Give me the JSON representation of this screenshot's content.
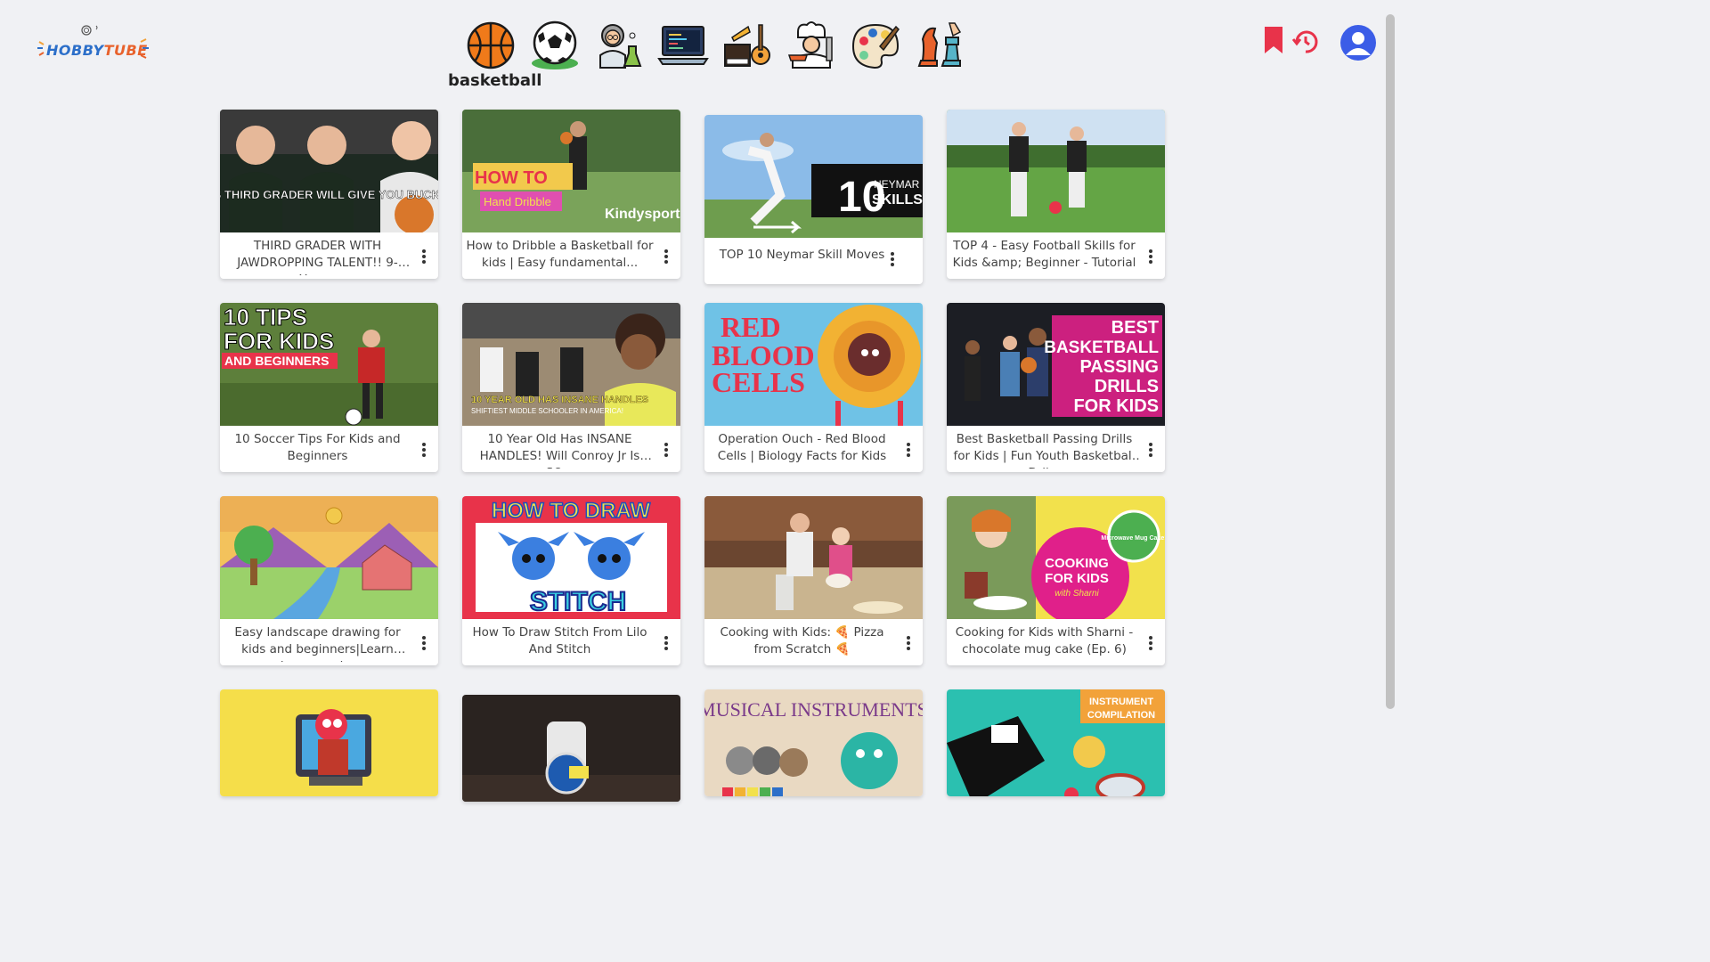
{
  "header": {
    "logo_text_a": "HOBBY",
    "logo_text_b": "TUBE",
    "categories": [
      {
        "name": "basketball",
        "icon": "basketball-icon",
        "selected": true
      },
      {
        "name": "soccer",
        "icon": "soccer-ball-icon"
      },
      {
        "name": "science",
        "icon": "scientist-icon"
      },
      {
        "name": "coding",
        "icon": "laptop-code-icon"
      },
      {
        "name": "music",
        "icon": "musical-instruments-icon"
      },
      {
        "name": "cooking",
        "icon": "chef-icon"
      },
      {
        "name": "art",
        "icon": "palette-icon"
      },
      {
        "name": "chess",
        "icon": "chess-icon"
      }
    ],
    "selected_label": "basketball"
  },
  "videos": [
    {
      "title": "THIRD GRADER WITH JAWDROPPING TALENT!! 9-Year...",
      "thumb_caption": "THIS THIRD GRADER WILL GIVE YOU BUCKETS"
    },
    {
      "title": "How to Dribble a Basketball for kids | Easy fundamental...",
      "thumb_caption": "HOW TO",
      "thumb_caption2": "Hand Dribble",
      "thumb_brand": "Kindysport"
    },
    {
      "title": "TOP 10 Neymar Skill Moves",
      "thumb_caption": "10",
      "thumb_caption2": "NEYMAR",
      "thumb_caption3": "SKILLS"
    },
    {
      "title": "TOP 4 - Easy Football Skills for Kids &amp; Beginner - Tutorial"
    },
    {
      "title": "10 Soccer Tips For Kids and Beginners",
      "thumb_caption": "10 TIPS",
      "thumb_caption2": "FOR KIDS",
      "thumb_caption3": "AND BEGINNERS"
    },
    {
      "title": "10 Year Old Has INSANE HANDLES! Will Conroy Jr Is SO...",
      "thumb_caption": "10 YEAR OLD HAS INSANE HANDLES",
      "thumb_caption2": "SHIFTIEST MIDDLE SCHOOLER IN AMERICA!"
    },
    {
      "title": "Operation Ouch - Red Blood Cells | Biology Facts for Kids",
      "thumb_caption": "RED",
      "thumb_caption2": "BLOOD",
      "thumb_caption3": "CELLS"
    },
    {
      "title": "Best Basketball Passing Drills for Kids | Fun Youth Basketball Dril...",
      "thumb_caption": "BEST",
      "thumb_caption2": "BASKETBALL",
      "thumb_caption3": "PASSING",
      "thumb_caption4": "DRILLS",
      "thumb_caption5": "FOR KIDS"
    },
    {
      "title": "Easy landscape drawing for kids and beginners|Learn house and..."
    },
    {
      "title": "How To Draw Stitch From Lilo And Stitch",
      "thumb_caption": "HOW TO DRAW",
      "thumb_caption2": "STITCH"
    },
    {
      "title": "Cooking with Kids: 🍕 Pizza from Scratch 🍕"
    },
    {
      "title": "Cooking for Kids with Sharni - chocolate mug cake (Ep. 6)",
      "thumb_caption": "COOKING",
      "thumb_caption2": "FOR KIDS",
      "thumb_caption3": "with Sharni",
      "thumb_caption4": "Microwave Mug Cake!"
    },
    {
      "title": ""
    },
    {
      "title": ""
    },
    {
      "title": "",
      "thumb_caption": "MUSICAL INSTRUMENTS"
    },
    {
      "title": "",
      "thumb_caption": "INSTRUMENT",
      "thumb_caption2": "COMPILATION"
    }
  ],
  "colors": {
    "accent": "#3b5de7",
    "bookmark": "#e8334a",
    "history": "#e8334a"
  }
}
